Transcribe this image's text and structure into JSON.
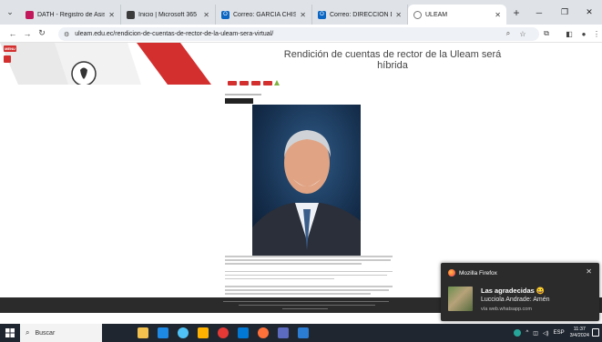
{
  "browser": {
    "tabs": [
      {
        "title": "DATH - Registro de Asistencia",
        "icon_color": "#c2185b",
        "active": false
      },
      {
        "title": "Inicio | Microsoft 365",
        "icon_color": "#3b3b3b",
        "active": false
      },
      {
        "title": "Correo: GARCIA CHISPE CARLOS",
        "icon_color": "#0a66c2",
        "active": false
      },
      {
        "title": "Correo: DIRECCIÓN DE COMUNICACIÓN",
        "icon_color": "#0a66c2",
        "active": false
      },
      {
        "title": "ULEAM",
        "icon_color": "#777777",
        "active": true
      }
    ],
    "new_tab_label": "+",
    "url": "uleam.edu.ec/rendicion-de-cuentas-de-rector-de-la-uleam-sera-virtual/"
  },
  "page": {
    "headline": "Rendición de cuentas de rector de la Uleam será híbrida",
    "badge_label": "MENU",
    "brand_red": "#d32f2f"
  },
  "notification": {
    "app_name": "Mozilla Firefox",
    "title": "Las agradecidas 😀",
    "body": "Lucciola Andrade: Amén",
    "source": "vía web.whatsapp.com"
  },
  "taskbar": {
    "search_placeholder": "Buscar",
    "language": "ESP",
    "time": "11:37",
    "date": "3/4/2024",
    "apps": [
      "#f2c14e",
      "#1e88e5",
      "#4fc3f7",
      "#ffb300",
      "#e53935",
      "#0078d4",
      "#ff7139",
      "#5c6bc0",
      "#2b7cd3"
    ]
  }
}
